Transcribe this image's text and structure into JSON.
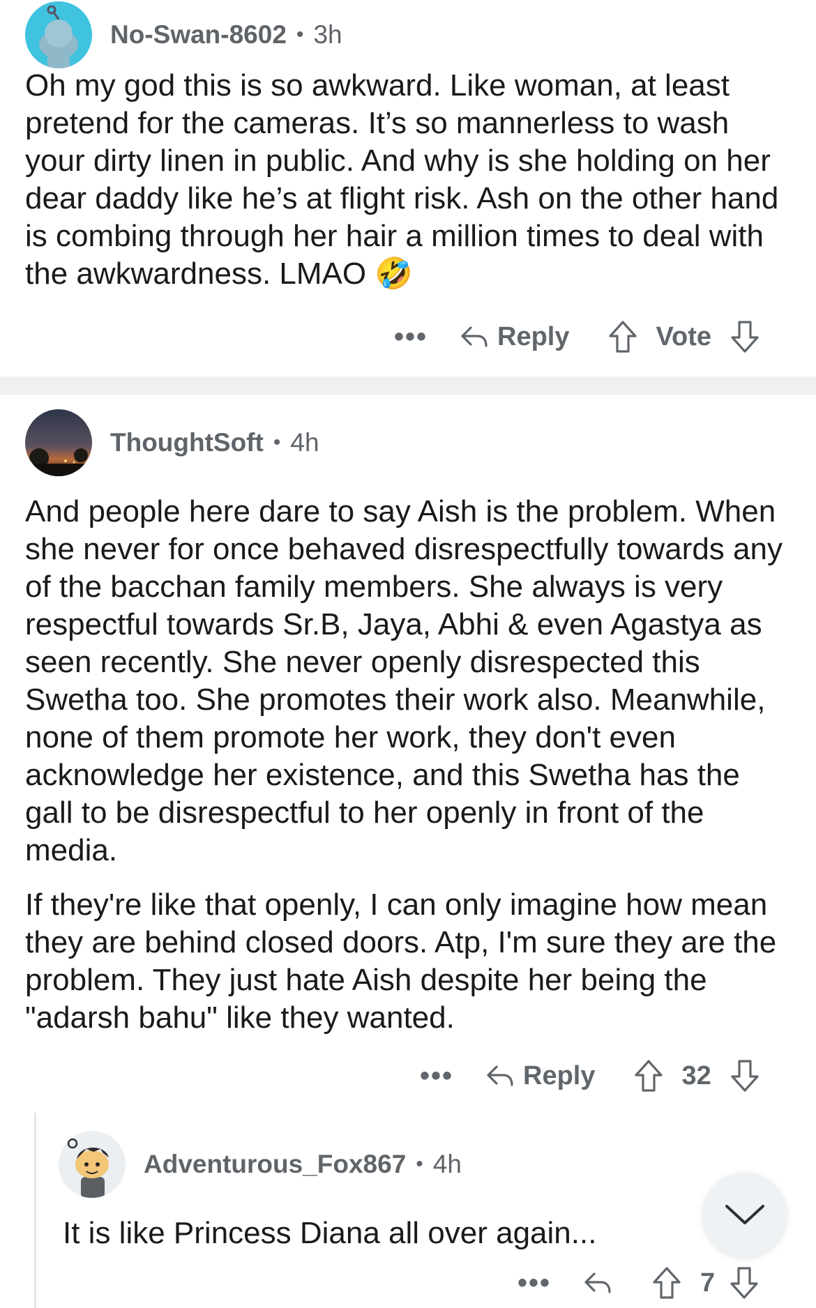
{
  "comments": [
    {
      "author": "No-Swan-8602",
      "age": "3h",
      "body": [
        "Oh my god this is so awkward. Like woman, at least pretend for the cameras. It’s so mannerless to wash your dirty linen in public. And why is she holding on her dear daddy like he’s at flight risk. Ash on the other hand is combing through her hair a million times to deal with the awkwardness. LMAO"
      ],
      "emoji": "🤣",
      "more_label": "•••",
      "reply_label": "Reply",
      "vote_label": "Vote"
    },
    {
      "author": "ThoughtSoft",
      "age": "4h",
      "body": [
        "And people here dare to say Aish is the problem. When she never for once behaved disrespectfully towards any of the bacchan family members. She always is very respectful towards Sr.B, Jaya, Abhi & even Agastya as seen recently. She never openly disrespected this Swetha too. She promotes their work also. Meanwhile, none of them promote her work, they don't even acknowledge her existence, and this Swetha has the gall to be disrespectful to her openly in front of the media.",
        "If they're like that openly, I can only imagine how mean they are behind closed doors. Atp, I'm sure they are the problem. They just hate Aish despite her being the \"adarsh bahu\" like they wanted."
      ],
      "more_label": "•••",
      "reply_label": "Reply",
      "vote_count": "32"
    },
    {
      "author": "Adventurous_Fox867",
      "age": "4h",
      "body": [
        "It is like Princess Diana all over again..."
      ],
      "more_label": "•••",
      "vote_count": "7"
    }
  ],
  "separator": "•",
  "icons": {
    "reply": "reply-arrow-icon",
    "upvote": "upvote-arrow-icon",
    "downvote": "downvote-arrow-icon",
    "collapse": "chevron-down-icon"
  },
  "colors": {
    "avatar1_bg": "#3fc3df",
    "divider": "#eef0f1",
    "muted_text": "#5f6469"
  }
}
